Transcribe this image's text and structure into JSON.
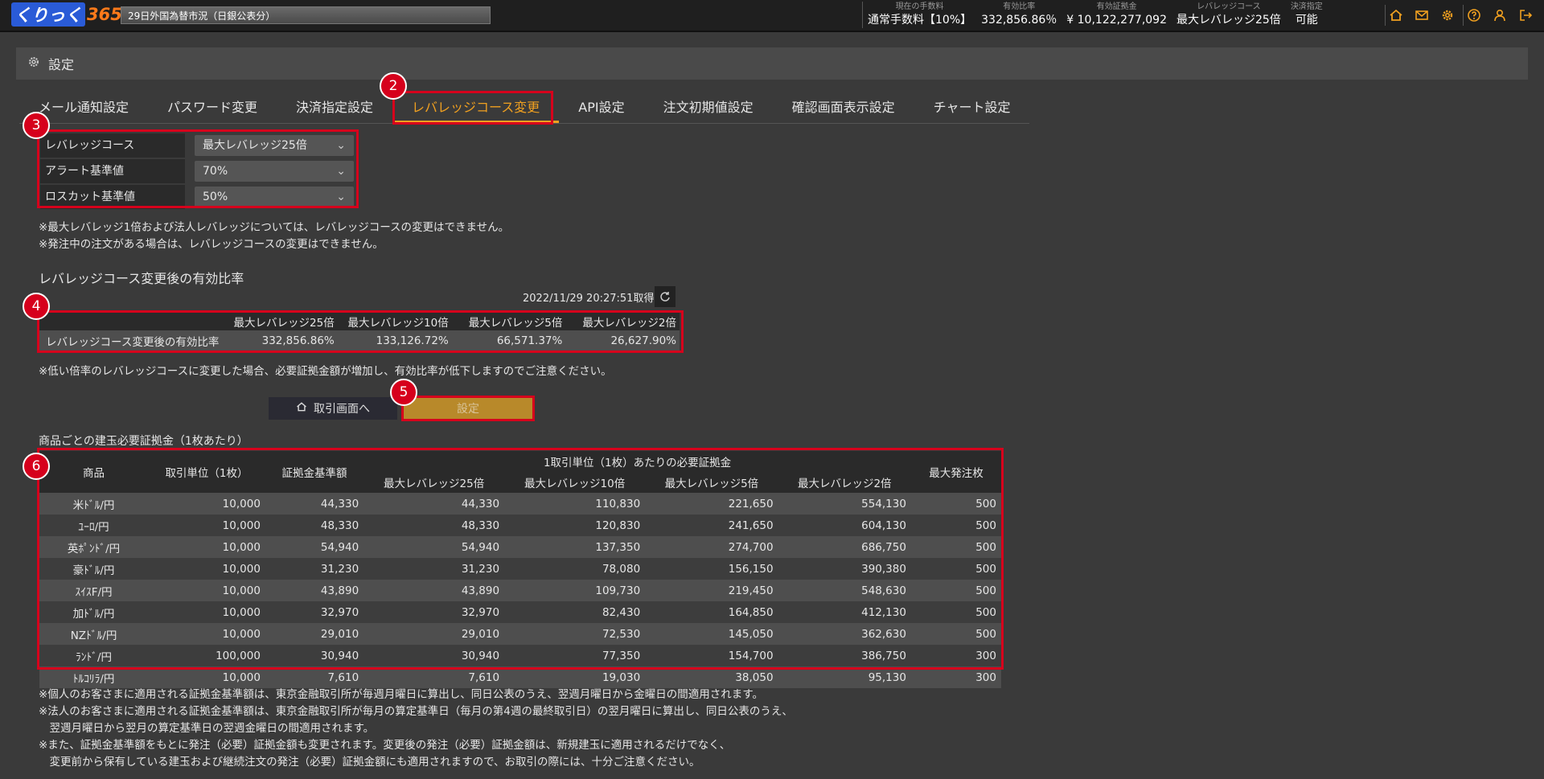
{
  "topbar": {
    "logo_a": "くりっく",
    "logo_b": "365",
    "ticker": "29日外国為替市況（日銀公表分）",
    "stats": [
      {
        "key": "現在の手数料",
        "value": "通常手数料【10%】"
      },
      {
        "key": "有効比率",
        "value": "332,856.86％"
      },
      {
        "key": "有効証拠金",
        "value": "¥ 10,122,277,092"
      },
      {
        "key": "レバレッジコース",
        "value": "最大レバレッジ25倍"
      },
      {
        "key": "決済指定",
        "value": "可能"
      }
    ]
  },
  "header": {
    "title": "設定"
  },
  "tabs": [
    "メール通知設定",
    "パスワード変更",
    "決済指定設定",
    "レバレッジコース変更",
    "API設定",
    "注文初期値設定",
    "確認画面表示設定",
    "チャート設定"
  ],
  "form": {
    "rows": [
      {
        "label": "レバレッジコース",
        "value": "最大レバレッジ25倍"
      },
      {
        "label": "アラート基準値",
        "value": "70%"
      },
      {
        "label": "ロスカット基準値",
        "value": "50%"
      }
    ]
  },
  "notes": {
    "n1": "※最大レバレッジ1倍および法人レバレッジについては、レバレッジコースの変更はできません。",
    "n2": "※発注中の注文がある場合は、レバレッジコースの変更はできません。",
    "ratio_title": "レバレッジコース変更後の有効比率",
    "timestamp": "2022/11/29 20:27:51取得",
    "n3": "※低い倍率のレバレッジコースに変更した場合、必要証拠金額が増加し、有効比率が低下しますのでご注意ください。",
    "f1": "※個人のお客さまに適用される証拠金基準額は、東京金融取引所が毎週月曜日に算出し、同日公表のうえ、翌週月曜日から金曜日の間適用されます。",
    "f2": "※法人のお客さまに適用される証拠金基準額は、東京金融取引所が毎月の算定基準日（毎月の第4週の最終取引日）の翌月曜日に算出し、同日公表のうえ、",
    "f3": "　翌週月曜日から翌月の算定基準日の翌週金曜日の間適用されます。",
    "f4": "※また、証拠金基準額をもとに発注（必要）証拠金額も変更されます。変更後の発注（必要）証拠金額は、新規建玉に適用されるだけでなく、",
    "f5": "　変更前から保有している建玉および継続注文の発注（必要）証拠金額にも適用されますので、お取引の際には、十分ご注意ください。"
  },
  "ratio_table": {
    "headers": [
      "最大レバレッジ25倍",
      "最大レバレッジ10倍",
      "最大レバレッジ5倍",
      "最大レバレッジ2倍"
    ],
    "row_label": "レバレッジコース変更後の有効比率",
    "values": [
      "332,856.86%",
      "133,126.72%",
      "66,571.37%",
      "26,627.90%"
    ]
  },
  "buttons": {
    "home": "取引画面へ",
    "set": "設定"
  },
  "margin_table": {
    "title": "商品ごとの建玉必要証拠金（1枚あたり）",
    "h_product": "商品",
    "h_unit": "取引単位（1枚）",
    "h_base": "証拠金基準額",
    "h_group": "1取引単位（1枚）あたりの必要証拠金",
    "h_levs": [
      "最大レバレッジ25倍",
      "最大レバレッジ10倍",
      "最大レバレッジ5倍",
      "最大レバレッジ2倍"
    ],
    "h_max": "最大発注枚",
    "rows": [
      [
        "米ﾄﾞﾙ/円",
        "10,000",
        "44,330",
        "44,330",
        "110,830",
        "221,650",
        "554,130",
        "500"
      ],
      [
        "ﾕｰﾛ/円",
        "10,000",
        "48,330",
        "48,330",
        "120,830",
        "241,650",
        "604,130",
        "500"
      ],
      [
        "英ﾎﾟﾝﾄﾞ/円",
        "10,000",
        "54,940",
        "54,940",
        "137,350",
        "274,700",
        "686,750",
        "500"
      ],
      [
        "豪ﾄﾞﾙ/円",
        "10,000",
        "31,230",
        "31,230",
        "78,080",
        "156,150",
        "390,380",
        "500"
      ],
      [
        "ｽｲｽF/円",
        "10,000",
        "43,890",
        "43,890",
        "109,730",
        "219,450",
        "548,630",
        "500"
      ],
      [
        "加ﾄﾞﾙ/円",
        "10,000",
        "32,970",
        "32,970",
        "82,430",
        "164,850",
        "412,130",
        "500"
      ],
      [
        "NZﾄﾞﾙ/円",
        "10,000",
        "29,010",
        "29,010",
        "72,530",
        "145,050",
        "362,630",
        "500"
      ],
      [
        "ﾗﾝﾄﾞ/円",
        "100,000",
        "30,940",
        "30,940",
        "77,350",
        "154,700",
        "386,750",
        "300"
      ],
      [
        "ﾄﾙｺﾘﾗ/円",
        "10,000",
        "7,610",
        "7,610",
        "19,030",
        "38,050",
        "95,130",
        "300"
      ]
    ]
  },
  "badges": [
    "2",
    "3",
    "4",
    "5",
    "6"
  ]
}
